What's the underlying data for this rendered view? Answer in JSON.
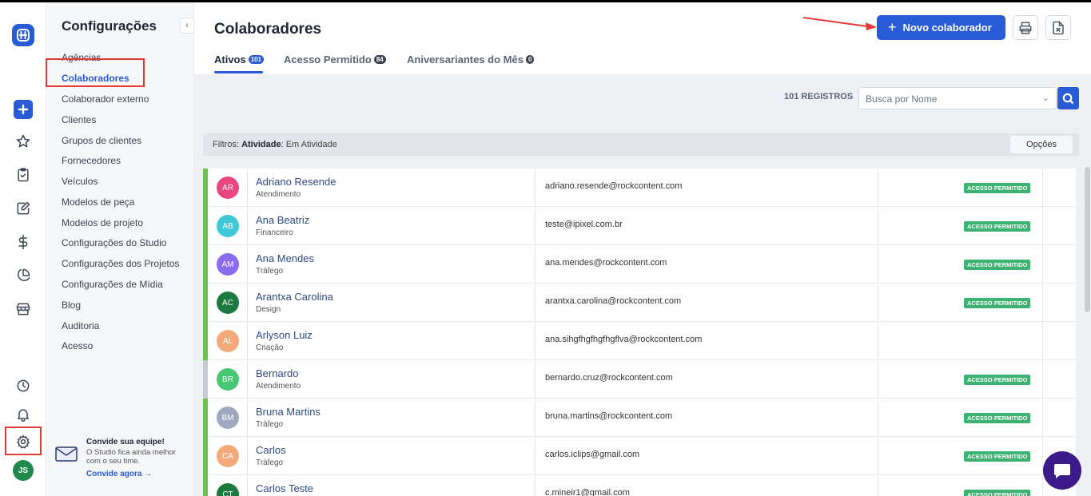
{
  "sidebar": {
    "title": "Configurações",
    "items": [
      {
        "label": "Agências"
      },
      {
        "label": "Colaboradores",
        "active": true
      },
      {
        "label": "Colaborador externo"
      },
      {
        "label": "Clientes"
      },
      {
        "label": "Grupos de clientes"
      },
      {
        "label": "Fornecedores"
      },
      {
        "label": "Veículos"
      },
      {
        "label": "Modelos de peça"
      },
      {
        "label": "Modelos de projeto"
      },
      {
        "label": "Configurações do Studio"
      },
      {
        "label": "Configurações dos Projetos"
      },
      {
        "label": "Configurações de Mídia"
      },
      {
        "label": "Blog"
      },
      {
        "label": "Auditoria"
      },
      {
        "label": "Acesso"
      }
    ],
    "invite": {
      "title": "Convide sua equipe!",
      "text": "O Studio fica ainda melhor com o seu time.",
      "link": "Convide agora"
    }
  },
  "rail": {
    "user_initials": "JS",
    "icons": [
      "logo-icon",
      "plus-icon",
      "star-icon",
      "clipboard-icon",
      "edit-icon",
      "dollar-icon",
      "pie-chart-icon",
      "store-icon",
      "clock-icon",
      "bell-icon",
      "gear-icon"
    ]
  },
  "header": {
    "title": "Colaboradores",
    "new_button": "Novo colaborador",
    "tabs": [
      {
        "label": "Ativos",
        "count": "101"
      },
      {
        "label": "Acesso Permitido",
        "count": "84"
      },
      {
        "label": "Aniversariantes do Mês",
        "count": "0"
      }
    ]
  },
  "toolbar": {
    "records": "101 REGISTROS",
    "search_placeholder": "Busca por Nome"
  },
  "filters": {
    "prefix": "Filtros:",
    "key": "Atividade",
    "value": ": Em Atividade",
    "options_button": "Opções"
  },
  "rows": [
    {
      "initials": "AR",
      "color": "#e8467c",
      "name": "Adriano Resende",
      "dept": "Atendimento",
      "email": "adriano.resende@rockcontent.com",
      "status": "ACESSO PERMITIDO",
      "active": true
    },
    {
      "initials": "AB",
      "color": "#3ec9d6",
      "name": "Ana Beatriz",
      "dept": "Financeiro",
      "email": "teste@ipixel.com.br",
      "status": "ACESSO PERMITIDO",
      "active": true
    },
    {
      "initials": "AM",
      "color": "#8a6cf0",
      "name": "Ana Mendes",
      "dept": "Tráfego",
      "email": "ana.mendes@rockcontent.com",
      "status": "ACESSO PERMITIDO",
      "active": true
    },
    {
      "initials": "AC",
      "color": "#1b7a3e",
      "name": "Arantxa Carolina",
      "dept": "Design",
      "email": "arantxa.carolina@rockcontent.com",
      "status": "ACESSO PERMITIDO",
      "active": true
    },
    {
      "initials": "AL",
      "color": "#f4a97a",
      "name": "Arlyson Luiz",
      "dept": "Criação",
      "email": "ana.sihgfhgfhgfhgflva@rockcontent.com",
      "status": "",
      "active": true
    },
    {
      "initials": "BR",
      "color": "#48c774",
      "name": "Bernardo",
      "dept": "Atendimento",
      "email": "bernardo.cruz@rockcontent.com",
      "status": "ACESSO PERMITIDO",
      "active": false
    },
    {
      "initials": "BM",
      "color": "#a0a8bd",
      "name": "Bruna Martins",
      "dept": "Tráfego",
      "email": "bruna.martins@rockcontent.com",
      "status": "ACESSO PERMITIDO",
      "active": true
    },
    {
      "initials": "CA",
      "color": "#f4a97a",
      "name": "Carlos",
      "dept": "Tráfego",
      "email": "carlos.iclips@gmail.com",
      "status": "ACESSO PERMITIDO",
      "active": true
    },
    {
      "initials": "CT",
      "color": "#1b7a3e",
      "name": "Carlos Teste",
      "dept": "",
      "email": "c.mineir1@gmail.com",
      "status": "ACESSO PERMITIDO",
      "active": true
    }
  ]
}
